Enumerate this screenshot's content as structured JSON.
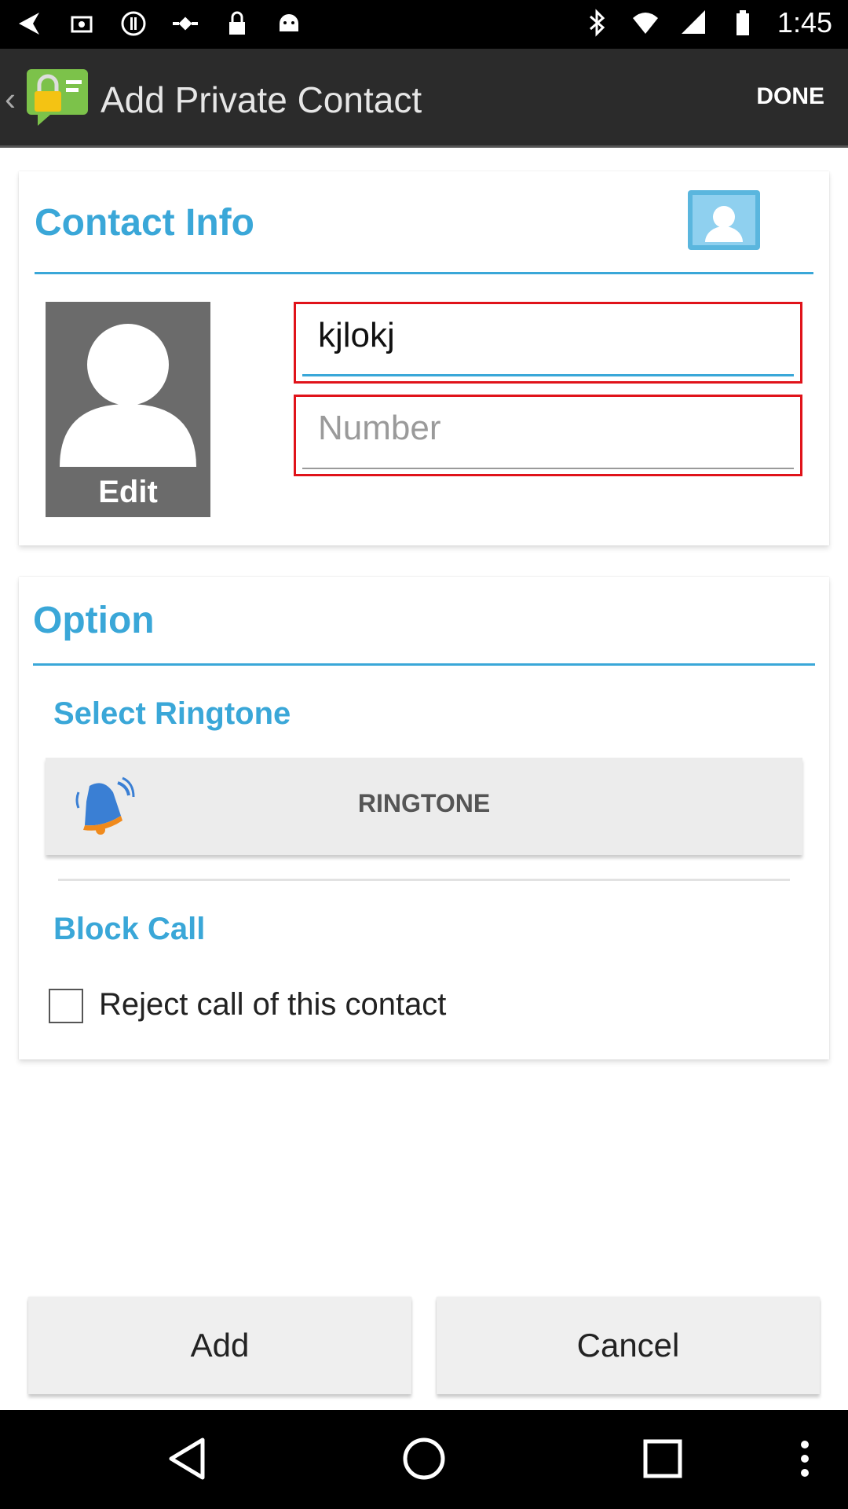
{
  "status_bar": {
    "time": "1:45",
    "icons_left": [
      "arrow-icon",
      "fake-gps-icon",
      "info-icon",
      "satellite-icon",
      "lock-icon",
      "android-icon"
    ],
    "icons_right": [
      "bluetooth-icon",
      "wifi-icon",
      "signal-icon",
      "battery-icon"
    ]
  },
  "action_bar": {
    "title": "Add Private Contact",
    "done_label": "DONE"
  },
  "contact_info": {
    "title": "Contact Info",
    "avatar_edit_label": "Edit",
    "name_value": "kjlokj",
    "number_placeholder": "Number"
  },
  "option": {
    "title": "Option",
    "select_ringtone_title": "Select Ringtone",
    "ringtone_button_label": "RINGTONE",
    "block_call_title": "Block Call",
    "reject_call_label": "Reject call of this contact",
    "reject_call_checked": false
  },
  "buttons": {
    "add_label": "Add",
    "cancel_label": "Cancel"
  },
  "colors": {
    "accent": "#3aa7d8",
    "highlight_border": "#e0131a",
    "action_bar": "#2b2b2b"
  }
}
